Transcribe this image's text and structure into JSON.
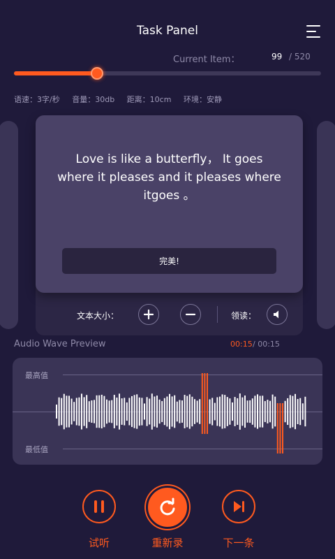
{
  "header": {
    "title": "Task Panel",
    "menu_icon": "menu-icon"
  },
  "progress": {
    "label": "Current Item：",
    "current": "99",
    "total": "/ 520",
    "fraction": 0.27
  },
  "stats": [
    "语速：3字/秒",
    "音量：30db",
    "距离：10cm",
    "环境：安静"
  ],
  "card": {
    "text": "Love is like a butterfly， It goes where it pleases and it pleases where itgoes 。",
    "perfect_label": "完美!"
  },
  "controls": {
    "text_size_label": "文本大小：",
    "read_label": "领读："
  },
  "wave": {
    "title": "Audio Wave Preview",
    "time_current": "00:15",
    "time_total": "/ 00:15",
    "max_label": "最高值",
    "min_label": "最低值"
  },
  "actions": {
    "listen_label": "试听",
    "rerecord_label": "重新录",
    "next_label": "下一条"
  },
  "colors": {
    "accent": "#ff5a1f",
    "background": "#1f1a3a",
    "card": "#4a4267"
  }
}
